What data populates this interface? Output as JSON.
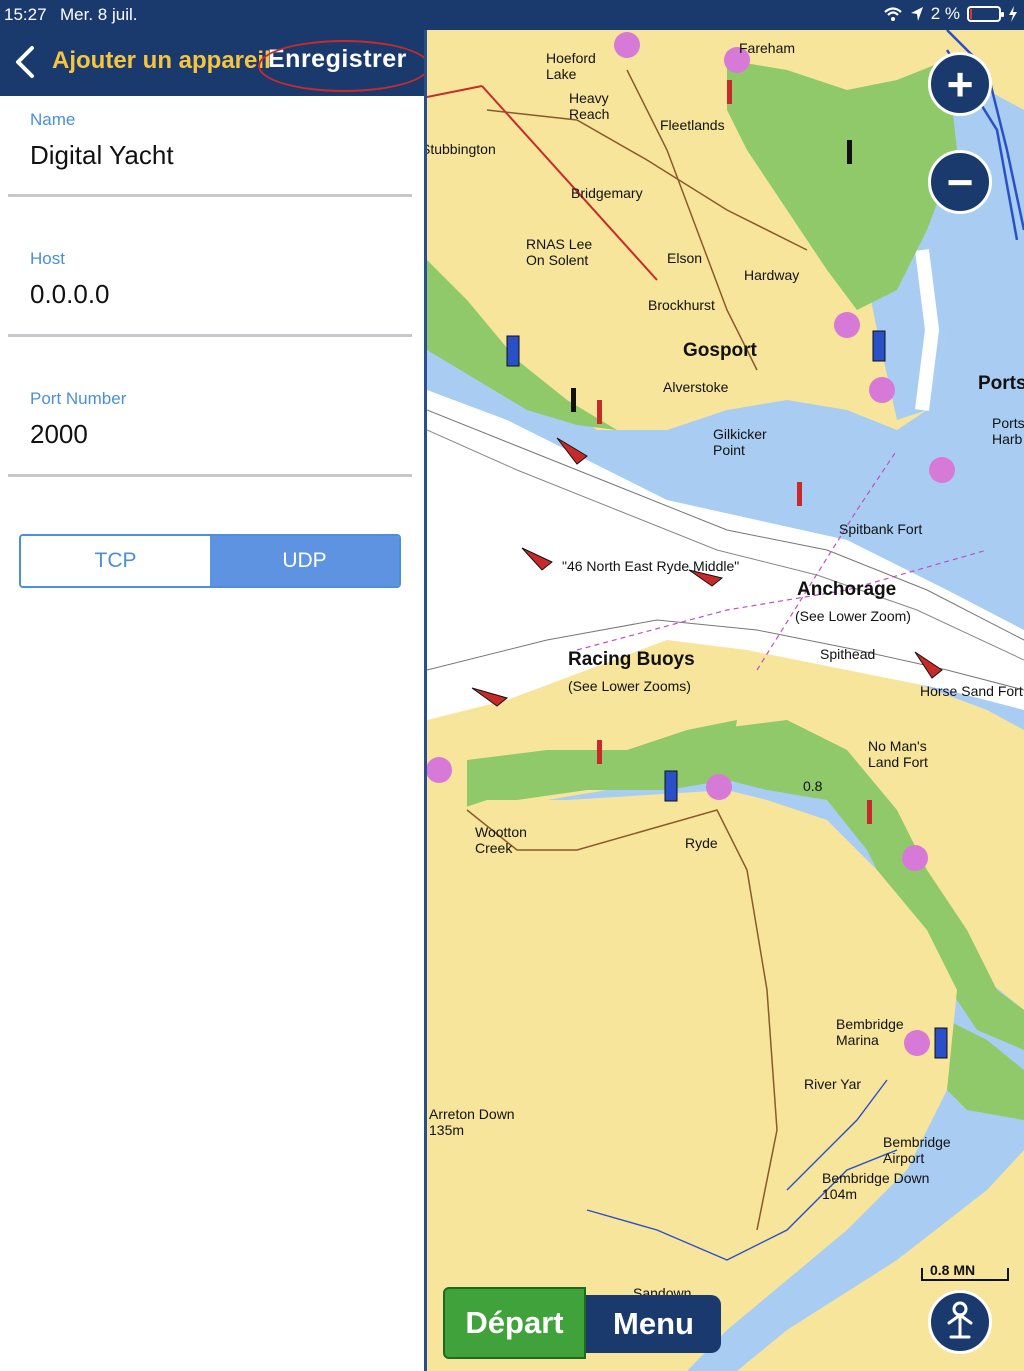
{
  "status_bar": {
    "time": "15:27",
    "date": "Mer. 8 juil.",
    "battery": "2 %",
    "battery_level": 0.02
  },
  "header": {
    "title": "Ajouter un appareil",
    "save_label": "Enregistrer"
  },
  "form": {
    "name": {
      "label": "Name",
      "value": "Digital Yacht"
    },
    "host": {
      "label": "Host",
      "value": "0.0.0.0"
    },
    "port": {
      "label": "Port Number",
      "value": "2000"
    },
    "protocol": {
      "options": [
        "TCP",
        "UDP"
      ],
      "selected": "UDP"
    }
  },
  "map": {
    "labels": {
      "hoeford": "Hoeford\nLake",
      "fareham": "Fareham",
      "heavy_reach": "Heavy\nReach",
      "fleetlands": "Fleetlands",
      "stubbington": "Stubbington",
      "bridgemary": "Bridgemary",
      "rnas": "RNAS Lee\nOn Solent",
      "elson": "Elson",
      "hardway": "Hardway",
      "brockhurst": "Brockhurst",
      "gosport": "Gosport",
      "alverstoke": "Alverstoke",
      "ports": "Ports",
      "ports_harb": "Ports\nHarb",
      "gilkicker": "Gilkicker\nPoint",
      "spitbank": "Spitbank Fort",
      "north_east_ryde": "\"46 North East Ryde Middle\"",
      "anchorage": "Anchorage",
      "anchorage_note": "(See Lower Zoom)",
      "spithead": "Spithead",
      "racing_buoys": "Racing Buoys",
      "racing_note": "(See Lower Zooms)",
      "horse_sand": "Horse Sand Fort",
      "no_mans": "No Man's\nLand Fort",
      "wootton": "Wootton\nCreek",
      "ryde": "Ryde",
      "bembridge_marina": "Bembridge\nMarina",
      "river_yar": "River Yar",
      "arreton": "Arreton Down\n135m",
      "bembridge_airport": "Bembridge\nAirport",
      "bembridge_down": "Bembridge Down\n104m",
      "sandown": "Sandown",
      "scale": "0.8 MN",
      "depth_08": "0.8"
    },
    "zoom_in": "+",
    "zoom_out": "−",
    "depart_label": "Départ",
    "menu_label": "Menu",
    "colors": {
      "land": "#f6e59a",
      "shallow": "#a9cdf2",
      "deep": "#ffffff",
      "green": "#8fc96a",
      "navy": "#1a3a6e"
    }
  }
}
